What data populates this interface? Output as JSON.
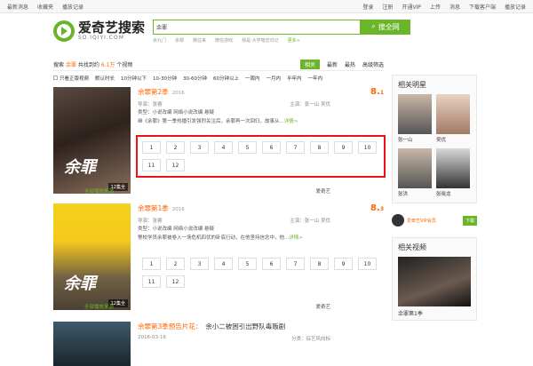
{
  "topbar": {
    "left": [
      "最新消息",
      "收藏夹",
      "播放记录"
    ],
    "right": [
      "登录",
      "注册",
      "开通VIP",
      "上传",
      "消息",
      "下载客户端",
      "播放记录"
    ]
  },
  "logo": {
    "title": "爱奇艺搜索",
    "sub": "SO.IQIYI.COM"
  },
  "search": {
    "value": "余罪",
    "button": "搜全网",
    "hot": [
      "余九门",
      "余罪",
      "微往来",
      "微信游戏",
      "我是·大学暗恋日记"
    ],
    "more": "更多>"
  },
  "info": {
    "prefix": "搜索",
    "query": "余罪",
    "middle": "共找到约",
    "count": "6.1万",
    "suffix": "个视频"
  },
  "tabs": [
    "相关",
    "最新",
    "最热",
    "高级筛选"
  ],
  "filters": [
    "只看正版视频",
    "默认时长",
    "10分钟以下",
    "10-30分钟",
    "30-60分钟",
    "60分钟以上",
    "一周内",
    "一月内",
    "半年内",
    "一年内"
  ],
  "results": [
    {
      "name": "余罪第2季",
      "year": "2016",
      "score": "8.",
      "score_small": "1",
      "director_label": "导演：",
      "director": "张睿",
      "cast_label": "主演：",
      "cast": "张一山 吴优",
      "type_label": "类型：",
      "type": "小说改编 网络小说改编 悬疑",
      "desc": "继《余罪》第一季热播引发强烈关注后，余罪再一次回归，故事从...",
      "desc_more": "详情>",
      "episodes": [
        "1",
        "2",
        "3",
        "4",
        "5",
        "6",
        "7",
        "8",
        "9",
        "10",
        "11",
        "12"
      ],
      "badge": "12集全",
      "poster_text": "余罪",
      "foot_left": "全部播放来源",
      "foot_right": "爱奇艺"
    },
    {
      "name": "余罪第1季",
      "year": "2016",
      "score": "8.",
      "score_small": "3",
      "director_label": "导演：",
      "director": "张睿",
      "cast_label": "主演：",
      "cast": "张一山 吴优",
      "type_label": "类型：",
      "type": "小说改编 网络小说改编 悬疑",
      "desc": "警校学员余罪被卷入一场危机四伏的卧底行动，在他坚持信念中，他...",
      "desc_more": "详情>",
      "episodes": [
        "1",
        "2",
        "3",
        "4",
        "5",
        "6",
        "7",
        "8",
        "9",
        "10",
        "11",
        "12"
      ],
      "badge": "12集全",
      "poster_text": "余罪",
      "foot_left": "全部播放来源",
      "foot_right": "爱奇艺"
    },
    {
      "name": "余罪第3季预告片花：",
      "extra": "余小二被困引出野队毒贩剧",
      "year": "2016-03-16",
      "label": "分类：",
      "cat": "综艺风向标"
    }
  ],
  "side": {
    "stars_title": "相关明星",
    "stars": [
      "张一山",
      "吴优",
      "张洪",
      "张晓龙"
    ],
    "promo": "爱奇艺VIP会员",
    "promo_btn": "下载",
    "videos_title": "相关视频",
    "video_cap": "余罪第1季"
  }
}
